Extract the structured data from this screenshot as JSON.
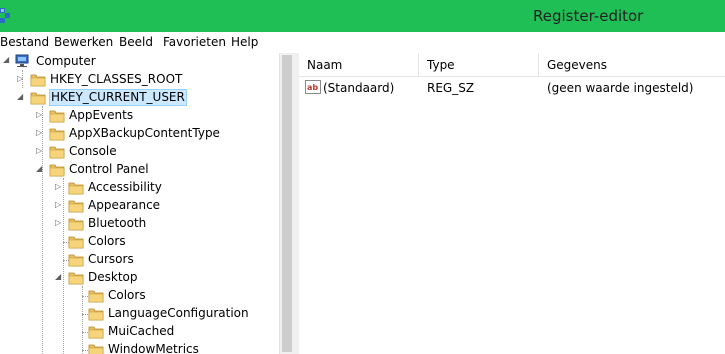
{
  "window": {
    "title": "Register-editor"
  },
  "menu": [
    "Bestand",
    "Bewerken",
    "Beeld",
    "Favorieten",
    "Help"
  ],
  "tree": {
    "root": "Computer",
    "nodes": [
      {
        "label": "HKEY_CLASSES_ROOT",
        "expander": "closed",
        "selected": false
      },
      {
        "label": "HKEY_CURRENT_USER",
        "expander": "open",
        "selected": true
      },
      {
        "label": "AppEvents",
        "expander": "closed",
        "selected": false
      },
      {
        "label": "AppXBackupContentType",
        "expander": "closed",
        "selected": false
      },
      {
        "label": "Console",
        "expander": "closed",
        "selected": false
      },
      {
        "label": "Control Panel",
        "expander": "open",
        "selected": false
      },
      {
        "label": "Accessibility",
        "expander": "closed",
        "selected": false
      },
      {
        "label": "Appearance",
        "expander": "closed",
        "selected": false
      },
      {
        "label": "Bluetooth",
        "expander": "closed",
        "selected": false
      },
      {
        "label": "Colors",
        "expander": "none",
        "selected": false
      },
      {
        "label": "Cursors",
        "expander": "none",
        "selected": false
      },
      {
        "label": "Desktop",
        "expander": "open",
        "selected": false
      },
      {
        "label": "Colors",
        "expander": "none",
        "selected": false
      },
      {
        "label": "LanguageConfiguration",
        "expander": "none",
        "selected": false
      },
      {
        "label": "MuiCached",
        "expander": "none",
        "selected": false
      },
      {
        "label": "WindowMetrics",
        "expander": "none",
        "selected": false
      }
    ]
  },
  "list": {
    "columns": [
      "Naam",
      "Type",
      "Gegevens"
    ],
    "rows": [
      {
        "name": "(Standaard)",
        "type": "REG_SZ",
        "data": "(geen waarde ingesteld)",
        "icon": "string-value-icon"
      }
    ]
  },
  "colors": {
    "titlebar": "#1fbf55",
    "selection": "#cce8ff",
    "folder": "#e8c060"
  }
}
